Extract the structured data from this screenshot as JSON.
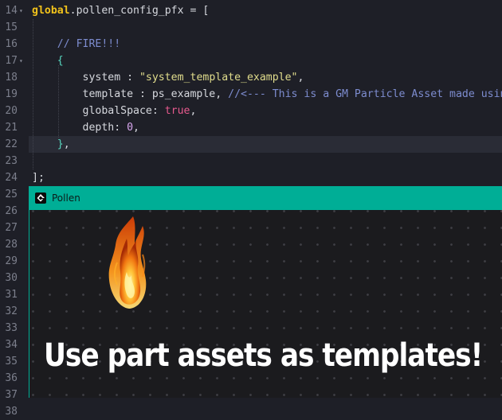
{
  "editor": {
    "lines": [
      {
        "num": "14",
        "tokens": [
          {
            "t": "global",
            "c": "kw"
          },
          {
            "t": ".pollen_config_pfx = ["
          }
        ]
      },
      {
        "num": "15",
        "tokens": []
      },
      {
        "num": "16",
        "tokens": [
          {
            "t": "    "
          },
          {
            "t": "// FIRE!!!",
            "c": "cmt"
          }
        ]
      },
      {
        "num": "17",
        "tokens": [
          {
            "t": "    "
          },
          {
            "t": "{",
            "c": "brace"
          }
        ]
      },
      {
        "num": "18",
        "tokens": [
          {
            "t": "        system : "
          },
          {
            "t": "\"system_template_example\"",
            "c": "str"
          },
          {
            "t": ","
          }
        ]
      },
      {
        "num": "19",
        "tokens": [
          {
            "t": "        template : ps_example, "
          },
          {
            "t": "//<--- This is a GM Particle Asset made using GM's Particle Editor",
            "c": "cmt"
          }
        ]
      },
      {
        "num": "20",
        "tokens": [
          {
            "t": "        globalSpace: "
          },
          {
            "t": "true",
            "c": "bool"
          },
          {
            "t": ","
          }
        ]
      },
      {
        "num": "21",
        "tokens": [
          {
            "t": "        depth: "
          },
          {
            "t": "0",
            "c": "num"
          },
          {
            "t": ","
          }
        ]
      },
      {
        "num": "22",
        "tokens": [
          {
            "t": "    "
          },
          {
            "t": "}",
            "c": "brace"
          },
          {
            "t": ","
          }
        ]
      },
      {
        "num": "23",
        "tokens": []
      },
      {
        "num": "24",
        "tokens": [
          {
            "t": "];"
          }
        ]
      },
      {
        "num": "25",
        "tokens": []
      },
      {
        "num": "26",
        "tokens": []
      },
      {
        "num": "27",
        "tokens": []
      },
      {
        "num": "28",
        "tokens": []
      },
      {
        "num": "29",
        "tokens": []
      },
      {
        "num": "30",
        "tokens": []
      },
      {
        "num": "31",
        "tokens": []
      },
      {
        "num": "32",
        "tokens": []
      },
      {
        "num": "33",
        "tokens": []
      },
      {
        "num": "34",
        "tokens": []
      },
      {
        "num": "35",
        "tokens": []
      },
      {
        "num": "36",
        "tokens": []
      },
      {
        "num": "37",
        "tokens": []
      },
      {
        "num": "38",
        "tokens": []
      }
    ],
    "fold_markers": [
      "14",
      "17"
    ],
    "active_line": "22"
  },
  "overlay": {
    "title": "Pollen",
    "icon": "gamemaker-logo-icon",
    "caption": "Use part assets as templates!",
    "accent_color": "#00ae96"
  }
}
